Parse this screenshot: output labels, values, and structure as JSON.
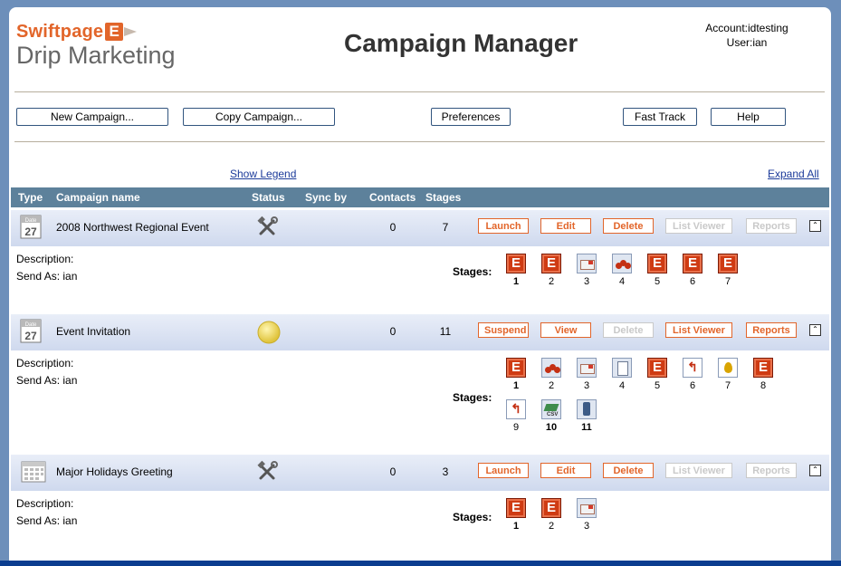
{
  "header": {
    "logo_top": "Swiftpage",
    "logo_e": "E",
    "logo_bottom": "Drip Marketing",
    "title": "Campaign Manager",
    "account": "Account:idtesting",
    "user": "User:ian"
  },
  "toolbar": {
    "new_campaign": "New Campaign...",
    "copy_campaign": "Copy Campaign...",
    "preferences": "Preferences",
    "fast_track": "Fast Track",
    "help": "Help"
  },
  "links": {
    "show_legend": "Show Legend",
    "expand_all": "Expand All"
  },
  "columns": {
    "type": "Type",
    "campaign_name": "Campaign name",
    "status": "Status",
    "sync_by": "Sync by",
    "contacts": "Contacts",
    "stages": "Stages"
  },
  "icons": {
    "date": "calendar-date-icon",
    "calendar": "calendar-icon",
    "tools": "tools-icon",
    "active": "yellow-circle-icon",
    "collapse": "collapse-icon"
  },
  "colors": {
    "accent": "#e2652a",
    "header_bar": "#5d819b",
    "link": "#1c3b9a",
    "row_gradient_top": "#e9eef8",
    "row_gradient_bottom": "#cfd9ee"
  },
  "calendar_icon": {
    "date_label": "Date",
    "day": "27"
  },
  "campaigns": [
    {
      "name": "2008 Northwest Regional Event",
      "contacts": "0",
      "stages": "7",
      "buttons": [
        "Launch",
        "Edit",
        "Delete",
        "List Viewer",
        "Reports"
      ],
      "description_label": "Description:",
      "send_as": "Send As: ian",
      "stages_label": "Stages:",
      "stage_numbers": [
        "1",
        "2",
        "3",
        "4",
        "5",
        "6",
        "7"
      ]
    },
    {
      "name": "Event Invitation",
      "contacts": "0",
      "stages": "11",
      "buttons": [
        "Suspend",
        "View",
        "Delete",
        "List Viewer",
        "Reports"
      ],
      "description_label": "Description:",
      "send_as": "Send As: ian",
      "stages_label": "Stages:",
      "stage_numbers": [
        "1",
        "2",
        "3",
        "4",
        "5",
        "6",
        "7",
        "8",
        "9",
        "10",
        "11"
      ]
    },
    {
      "name": "Major Holidays Greeting",
      "contacts": "0",
      "stages": "3",
      "buttons": [
        "Launch",
        "Edit",
        "Delete",
        "List Viewer",
        "Reports"
      ],
      "description_label": "Description:",
      "send_as": "Send As: ian",
      "stages_label": "Stages:",
      "stage_numbers": [
        "1",
        "2",
        "3"
      ]
    }
  ],
  "stage_icon_labels": {
    "email": "E",
    "branch": "↰",
    "csv": "CSV"
  }
}
